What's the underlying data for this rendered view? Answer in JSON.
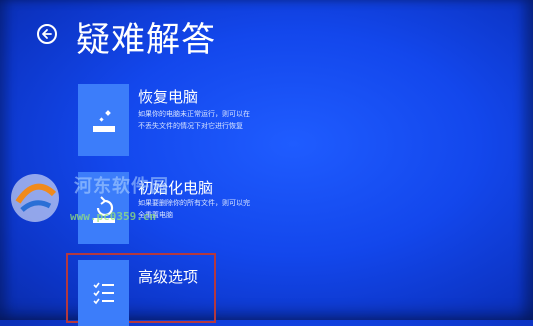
{
  "page": {
    "title": "疑难解答",
    "accent_color": "#1347ec",
    "tile_color": "#3c7dfa",
    "highlight_color": "#b3393f"
  },
  "options": [
    {
      "title": "恢复电脑",
      "desc_line1": "如果你的电脑未正常运行，则可以在",
      "desc_line2": "不丢失文件的情况下对它进行恢复",
      "icon": "refresh-pc-icon"
    },
    {
      "title": "初始化电脑",
      "desc_line1": "如果要删除你的所有文件，则可以完",
      "desc_line2": "全重置电脑",
      "icon": "reset-pc-icon"
    },
    {
      "title": "高级选项",
      "icon": "advanced-options-icon"
    }
  ],
  "watermark": {
    "text": "河东软件园",
    "url": "www.pc0359.cn"
  }
}
